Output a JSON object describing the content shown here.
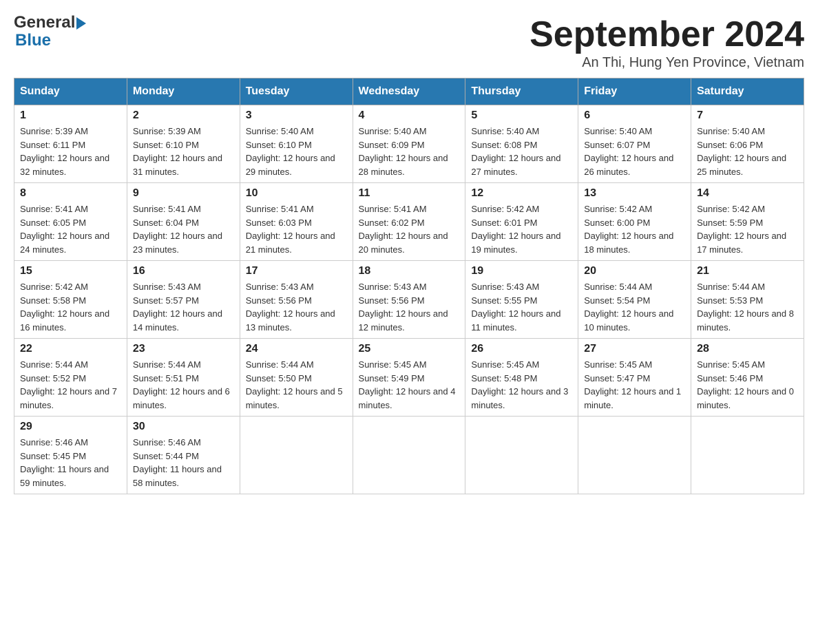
{
  "header": {
    "logo_general": "General",
    "logo_blue": "Blue",
    "month_title": "September 2024",
    "location": "An Thi, Hung Yen Province, Vietnam"
  },
  "weekdays": [
    "Sunday",
    "Monday",
    "Tuesday",
    "Wednesday",
    "Thursday",
    "Friday",
    "Saturday"
  ],
  "weeks": [
    [
      {
        "day": "1",
        "sunrise": "5:39 AM",
        "sunset": "6:11 PM",
        "daylight": "12 hours and 32 minutes."
      },
      {
        "day": "2",
        "sunrise": "5:39 AM",
        "sunset": "6:10 PM",
        "daylight": "12 hours and 31 minutes."
      },
      {
        "day": "3",
        "sunrise": "5:40 AM",
        "sunset": "6:10 PM",
        "daylight": "12 hours and 29 minutes."
      },
      {
        "day": "4",
        "sunrise": "5:40 AM",
        "sunset": "6:09 PM",
        "daylight": "12 hours and 28 minutes."
      },
      {
        "day": "5",
        "sunrise": "5:40 AM",
        "sunset": "6:08 PM",
        "daylight": "12 hours and 27 minutes."
      },
      {
        "day": "6",
        "sunrise": "5:40 AM",
        "sunset": "6:07 PM",
        "daylight": "12 hours and 26 minutes."
      },
      {
        "day": "7",
        "sunrise": "5:40 AM",
        "sunset": "6:06 PM",
        "daylight": "12 hours and 25 minutes."
      }
    ],
    [
      {
        "day": "8",
        "sunrise": "5:41 AM",
        "sunset": "6:05 PM",
        "daylight": "12 hours and 24 minutes."
      },
      {
        "day": "9",
        "sunrise": "5:41 AM",
        "sunset": "6:04 PM",
        "daylight": "12 hours and 23 minutes."
      },
      {
        "day": "10",
        "sunrise": "5:41 AM",
        "sunset": "6:03 PM",
        "daylight": "12 hours and 21 minutes."
      },
      {
        "day": "11",
        "sunrise": "5:41 AM",
        "sunset": "6:02 PM",
        "daylight": "12 hours and 20 minutes."
      },
      {
        "day": "12",
        "sunrise": "5:42 AM",
        "sunset": "6:01 PM",
        "daylight": "12 hours and 19 minutes."
      },
      {
        "day": "13",
        "sunrise": "5:42 AM",
        "sunset": "6:00 PM",
        "daylight": "12 hours and 18 minutes."
      },
      {
        "day": "14",
        "sunrise": "5:42 AM",
        "sunset": "5:59 PM",
        "daylight": "12 hours and 17 minutes."
      }
    ],
    [
      {
        "day": "15",
        "sunrise": "5:42 AM",
        "sunset": "5:58 PM",
        "daylight": "12 hours and 16 minutes."
      },
      {
        "day": "16",
        "sunrise": "5:43 AM",
        "sunset": "5:57 PM",
        "daylight": "12 hours and 14 minutes."
      },
      {
        "day": "17",
        "sunrise": "5:43 AM",
        "sunset": "5:56 PM",
        "daylight": "12 hours and 13 minutes."
      },
      {
        "day": "18",
        "sunrise": "5:43 AM",
        "sunset": "5:56 PM",
        "daylight": "12 hours and 12 minutes."
      },
      {
        "day": "19",
        "sunrise": "5:43 AM",
        "sunset": "5:55 PM",
        "daylight": "12 hours and 11 minutes."
      },
      {
        "day": "20",
        "sunrise": "5:44 AM",
        "sunset": "5:54 PM",
        "daylight": "12 hours and 10 minutes."
      },
      {
        "day": "21",
        "sunrise": "5:44 AM",
        "sunset": "5:53 PM",
        "daylight": "12 hours and 8 minutes."
      }
    ],
    [
      {
        "day": "22",
        "sunrise": "5:44 AM",
        "sunset": "5:52 PM",
        "daylight": "12 hours and 7 minutes."
      },
      {
        "day": "23",
        "sunrise": "5:44 AM",
        "sunset": "5:51 PM",
        "daylight": "12 hours and 6 minutes."
      },
      {
        "day": "24",
        "sunrise": "5:44 AM",
        "sunset": "5:50 PM",
        "daylight": "12 hours and 5 minutes."
      },
      {
        "day": "25",
        "sunrise": "5:45 AM",
        "sunset": "5:49 PM",
        "daylight": "12 hours and 4 minutes."
      },
      {
        "day": "26",
        "sunrise": "5:45 AM",
        "sunset": "5:48 PM",
        "daylight": "12 hours and 3 minutes."
      },
      {
        "day": "27",
        "sunrise": "5:45 AM",
        "sunset": "5:47 PM",
        "daylight": "12 hours and 1 minute."
      },
      {
        "day": "28",
        "sunrise": "5:45 AM",
        "sunset": "5:46 PM",
        "daylight": "12 hours and 0 minutes."
      }
    ],
    [
      {
        "day": "29",
        "sunrise": "5:46 AM",
        "sunset": "5:45 PM",
        "daylight": "11 hours and 59 minutes."
      },
      {
        "day": "30",
        "sunrise": "5:46 AM",
        "sunset": "5:44 PM",
        "daylight": "11 hours and 58 minutes."
      },
      null,
      null,
      null,
      null,
      null
    ]
  ]
}
